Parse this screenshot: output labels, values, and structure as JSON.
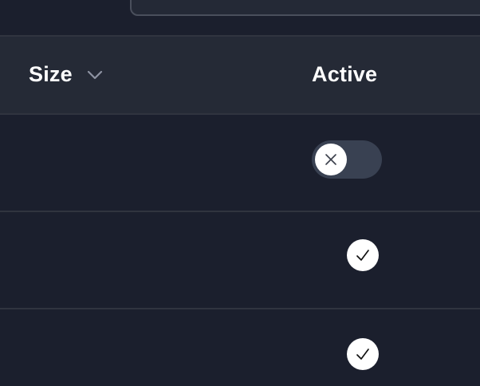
{
  "table": {
    "columns": [
      {
        "label": "Size",
        "sortable": true,
        "sort_icon": "chevron-down-icon"
      },
      {
        "label": "Active"
      }
    ],
    "rows": [
      {
        "active": false,
        "indicator_icon": "close-icon"
      },
      {
        "active": true,
        "indicator_icon": "checkmark-icon"
      },
      {
        "active": true,
        "indicator_icon": "checkmark-icon"
      }
    ]
  },
  "colors": {
    "background": "#1b1f2d",
    "header_background": "#252a36",
    "toggle_track": "#394152",
    "knob": "#ffffff"
  }
}
